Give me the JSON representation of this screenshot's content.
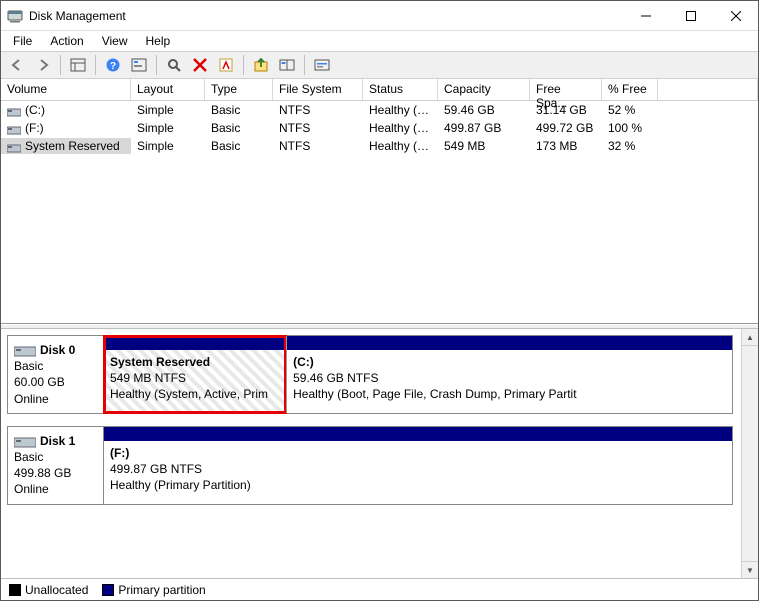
{
  "window": {
    "title": "Disk Management"
  },
  "menu": {
    "file": "File",
    "action": "Action",
    "view": "View",
    "help": "Help"
  },
  "columns": {
    "volume": "Volume",
    "layout": "Layout",
    "type": "Type",
    "fs": "File System",
    "status": "Status",
    "capacity": "Capacity",
    "free": "Free Spa...",
    "pct": "% Free"
  },
  "volumes": [
    {
      "name": "(C:)",
      "layout": "Simple",
      "type": "Basic",
      "fs": "NTFS",
      "status": "Healthy (B...",
      "capacity": "59.46 GB",
      "free": "31.14 GB",
      "pct": "52 %"
    },
    {
      "name": "(F:)",
      "layout": "Simple",
      "type": "Basic",
      "fs": "NTFS",
      "status": "Healthy (P...",
      "capacity": "499.87 GB",
      "free": "499.72 GB",
      "pct": "100 %"
    },
    {
      "name": "System Reserved",
      "layout": "Simple",
      "type": "Basic",
      "fs": "NTFS",
      "status": "Healthy (S...",
      "capacity": "549 MB",
      "free": "173 MB",
      "pct": "32 %",
      "selected": true
    }
  ],
  "disks": [
    {
      "id": "Disk 0",
      "type": "Basic",
      "size": "60.00 GB",
      "state": "Online",
      "partitions": [
        {
          "name": "System Reserved",
          "size_fs": "549 MB NTFS",
          "status": "Healthy (System, Active, Prim",
          "widthpct": 29,
          "selected": true
        },
        {
          "name": "(C:)",
          "size_fs": "59.46 GB NTFS",
          "status": "Healthy (Boot, Page File, Crash Dump, Primary Partit",
          "widthpct": 71
        }
      ]
    },
    {
      "id": "Disk 1",
      "type": "Basic",
      "size": "499.88 GB",
      "state": "Online",
      "partitions": [
        {
          "name": "(F:)",
          "size_fs": "499.87 GB NTFS",
          "status": "Healthy (Primary Partition)",
          "widthpct": 100
        }
      ]
    }
  ],
  "legend": {
    "unalloc": "Unallocated",
    "primary": "Primary partition"
  },
  "colors": {
    "primary_partition": "#000080",
    "selection_red": "#e80000"
  }
}
